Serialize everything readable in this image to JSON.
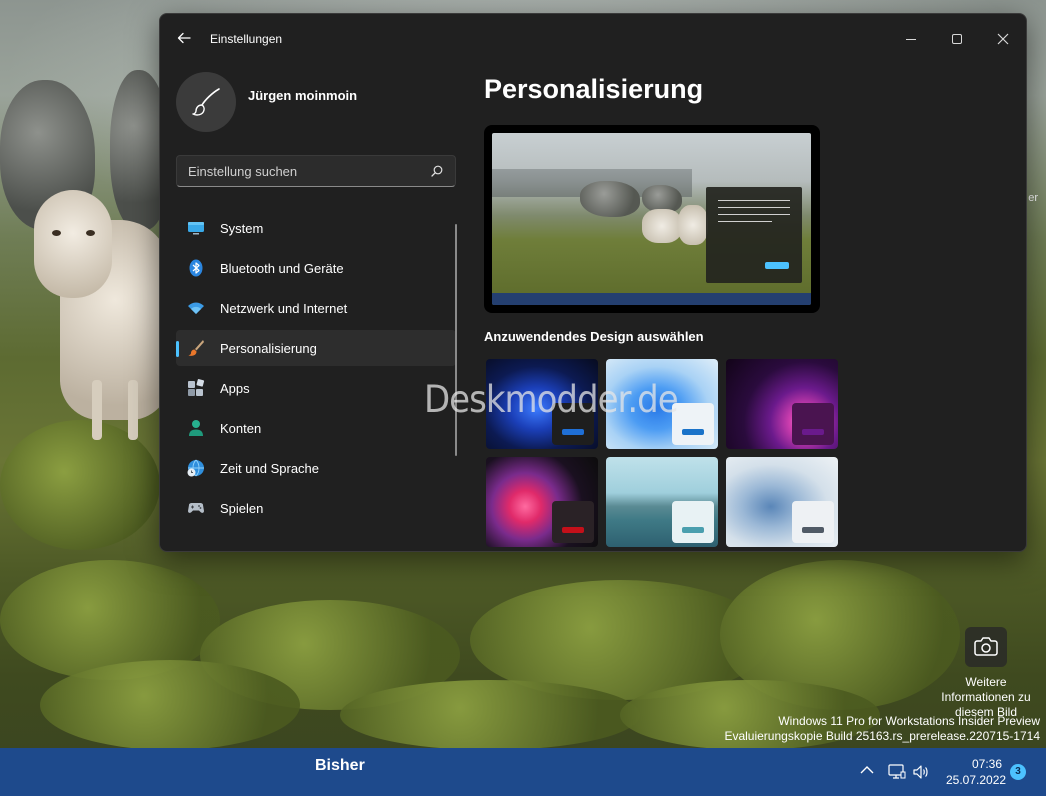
{
  "desktop": {
    "top_label": "",
    "side_label": "er"
  },
  "window": {
    "title": "Einstellungen",
    "controls": {
      "minimize": "minimize",
      "maximize": "maximize",
      "close": "close"
    }
  },
  "user": {
    "name": "Jürgen moinmoin"
  },
  "search": {
    "placeholder": "Einstellung suchen"
  },
  "sidebar": {
    "items": [
      {
        "label": "System",
        "icon": "monitor-icon"
      },
      {
        "label": "Bluetooth und Geräte",
        "icon": "bluetooth-icon"
      },
      {
        "label": "Netzwerk und Internet",
        "icon": "wifi-icon"
      },
      {
        "label": "Personalisierung",
        "icon": "brush-icon",
        "selected": true
      },
      {
        "label": "Apps",
        "icon": "apps-icon"
      },
      {
        "label": "Konten",
        "icon": "person-icon"
      },
      {
        "label": "Zeit und Sprache",
        "icon": "globe-clock-icon"
      },
      {
        "label": "Spielen",
        "icon": "gamepad-icon"
      }
    ]
  },
  "main": {
    "title": "Personalisierung",
    "design_heading": "Anzuwendendes Design auswählen",
    "themes": [
      {
        "name": "windows-dark-bloom",
        "accent": "#1f6fd6"
      },
      {
        "name": "windows-light-bloom",
        "accent": "#1a73c9"
      },
      {
        "name": "glow",
        "accent": "#6a1a8c"
      },
      {
        "name": "captured-motion",
        "accent": "#c4101a"
      },
      {
        "name": "sunrise",
        "accent": "#4a9fae"
      },
      {
        "name": "flow",
        "accent": "#505a66"
      }
    ]
  },
  "watermark": "Deskmodder.de",
  "camera_info": {
    "text": "Weitere Informationen zu diesem Bild"
  },
  "build_info": {
    "line1": "Windows 11 Pro for Workstations Insider Preview",
    "line2": "Evaluierungskopie Build 25163.rs_prerelease.220715-1714"
  },
  "taskbar": {
    "label": "Bisher",
    "time": "07:36",
    "date": "25.07.2022",
    "notifications": "3"
  },
  "colors": {
    "accent": "#4cc2ff",
    "window_bg": "#202020",
    "taskbar_bg": "#1e4a8c"
  }
}
